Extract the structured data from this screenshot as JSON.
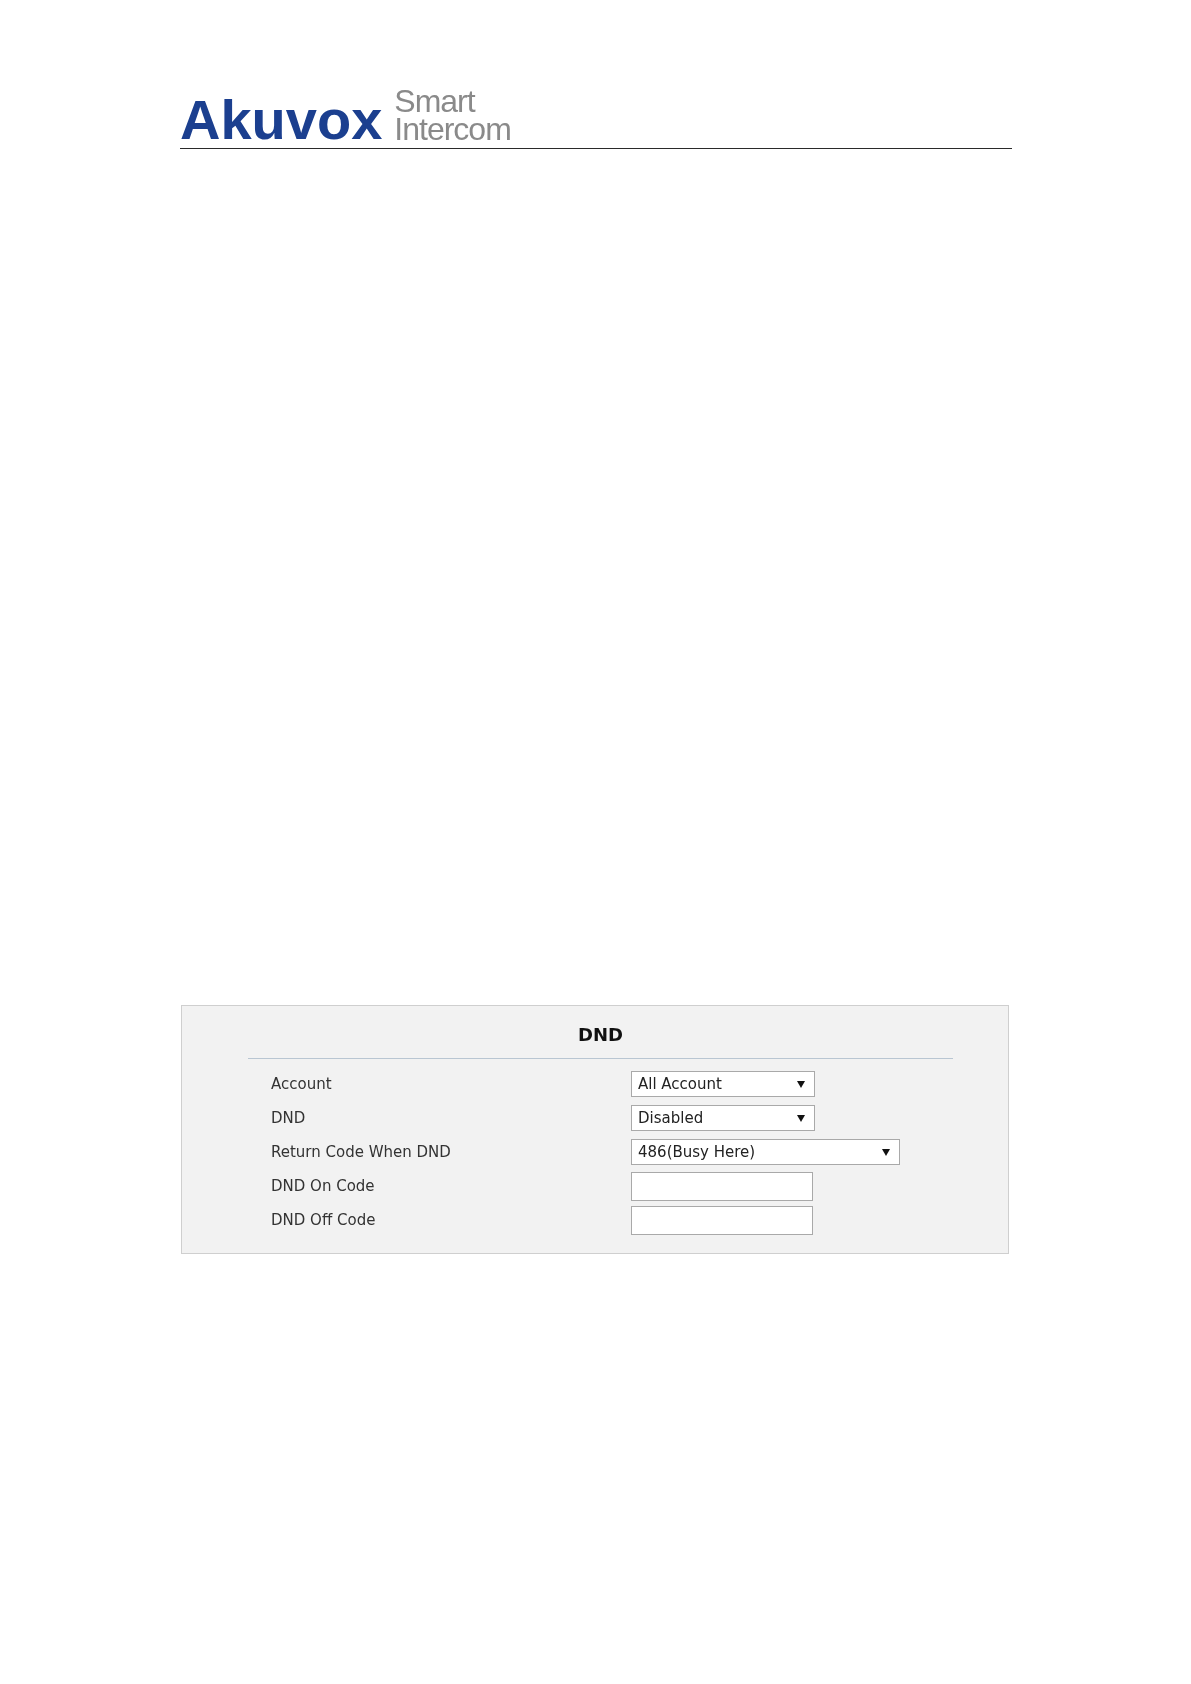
{
  "logo": {
    "brand": "Akuvox",
    "tagline": [
      "Smart",
      "Intercom"
    ]
  },
  "panel": {
    "title": "DND",
    "rows": [
      {
        "label": "Account",
        "kind": "select",
        "value": "All Account"
      },
      {
        "label": "DND",
        "kind": "select",
        "value": "Disabled"
      },
      {
        "label": "Return Code When DND",
        "kind": "select",
        "value": "486(Busy Here)"
      },
      {
        "label": "DND On Code",
        "kind": "input"
      },
      {
        "label": "DND Off Code",
        "kind": "input"
      }
    ]
  }
}
